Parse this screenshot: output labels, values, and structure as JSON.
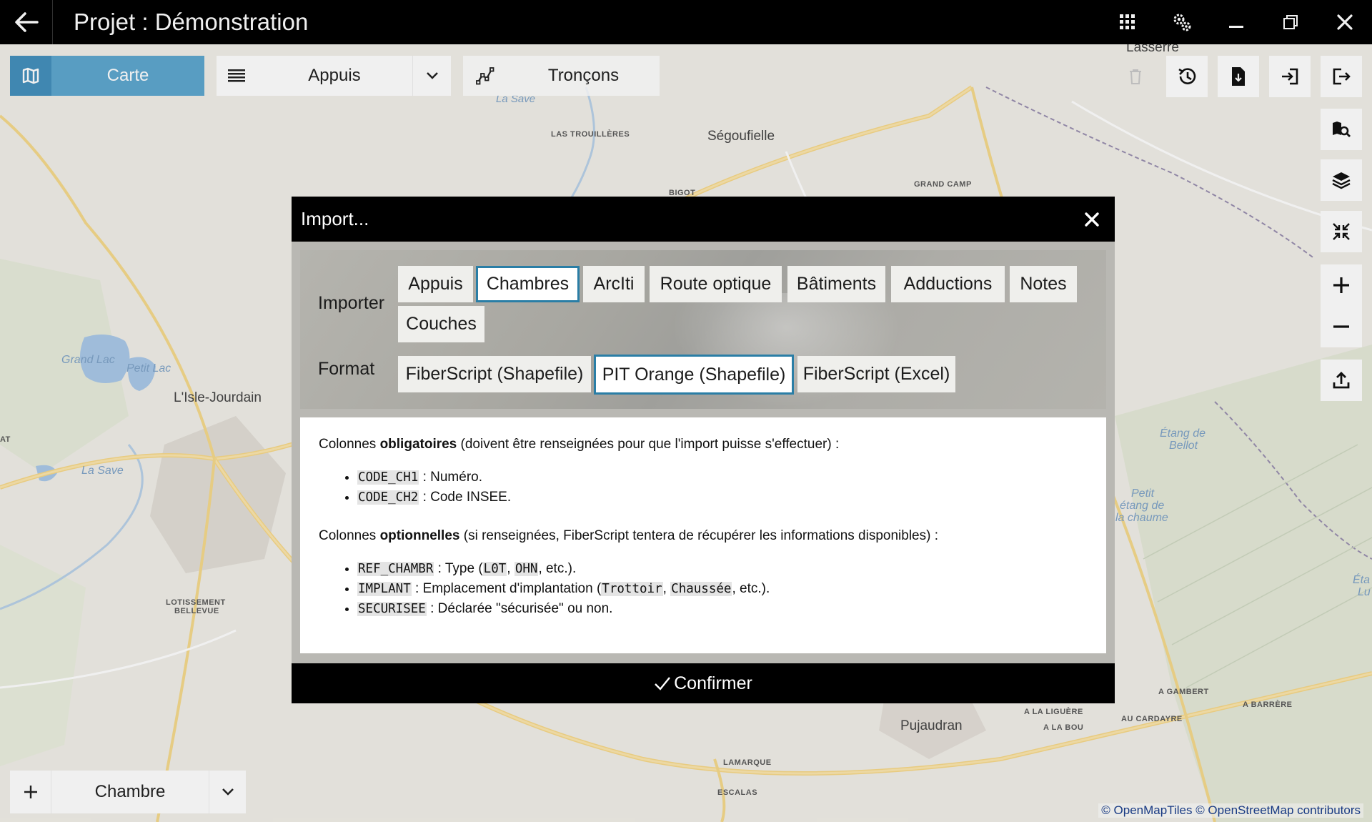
{
  "titlebar": {
    "title": "Projet : Démonstration",
    "icons": [
      "back-arrow-icon",
      "apps-grid-icon",
      "settings-gears-icon",
      "minimize-icon",
      "restore-icon",
      "close-icon"
    ]
  },
  "toolbar": {
    "carte_label": "Carte",
    "appuis_label": "Appuis",
    "troncons_label": "Tronçons",
    "accent_color": "#5ea7cf"
  },
  "bottom": {
    "add_label": "+",
    "chambre_label": "Chambre"
  },
  "map": {
    "labels": {
      "lasserre": "Lasserre",
      "la_save_top": "La Save",
      "las_trouilleres": "LAS TROUILLÈRES",
      "segoufielle": "Ségoufielle",
      "bigot": "BIGOT",
      "grand_camp": "GRAND CAMP",
      "grand_lac": "Grand Lac",
      "petit_lac": "Petit Lac",
      "isle_jourdain": "L'Isle-Jourdain",
      "la_save_left": "La Save",
      "at": "AT",
      "lotissement": "LOTISSEMENT",
      "bellevue": "BELLEVUE",
      "etang_de": "Étang de",
      "bellot": "Bellot",
      "petit": "Petit",
      "etang_de2": "étang de",
      "la_chaume": "la chaume",
      "eta": "Éta",
      "lu": "Lu",
      "a_gambert": "A GAMBERT",
      "a_la_liguere": "A LA LIGUÈRE",
      "a_barrere": "A BARRÈRE",
      "a_la_bou": "A LA BOU",
      "au_cardayre": "AU CARDAYRE",
      "pujaudran": "Pujaudran",
      "lamarque": "LAMARQUE",
      "escalas": "ESCALAS"
    },
    "attribution_a": "© OpenMapTiles",
    "attribution_b": "© OpenStreetMap contributors"
  },
  "modal": {
    "title": "Import...",
    "importer_label": "Importer",
    "format_label": "Format",
    "importer_options": [
      "Appuis",
      "Chambres",
      "ArcIti",
      "Route optique",
      "Bâtiments",
      "Adductions",
      "Notes",
      "Couches"
    ],
    "importer_selected": "Chambres",
    "format_options": [
      "FiberScript (Shapefile)",
      "PIT Orange (Shapefile)",
      "FiberScript (Excel)"
    ],
    "format_selected": "PIT Orange (Shapefile)",
    "selection_color": "#2a7ea6",
    "info": {
      "required_pre": "Colonnes ",
      "required_bold": "obligatoires",
      "required_post": " (doivent être renseignées pour que l'import puisse s'effectuer) :",
      "required": [
        {
          "code": "CODE_CH1",
          "text": " : Numéro."
        },
        {
          "code": "CODE_CH2",
          "text": " : Code INSEE."
        }
      ],
      "optional_pre": "Colonnes ",
      "optional_bold": "optionnelles",
      "optional_post": " (si renseignées, FiberScript tentera de récupérer les informations disponibles) :",
      "opt1_code": "REF_CHAMBR",
      "opt1_a": " : Type (",
      "opt1_c1": "L0T",
      "opt1_sep": ", ",
      "opt1_c2": "OHN",
      "opt1_b": ", etc.).",
      "opt2_code": "IMPLANT",
      "opt2_a": " : Emplacement d'implantation (",
      "opt2_c1": "Trottoir",
      "opt2_sep": ", ",
      "opt2_c2": "Chaussée",
      "opt2_b": ", etc.).",
      "opt3_code": "SECURISEE",
      "opt3_a": " : Déclarée \"sécurisée\" ou non."
    },
    "confirm_label": "Confirmer"
  }
}
